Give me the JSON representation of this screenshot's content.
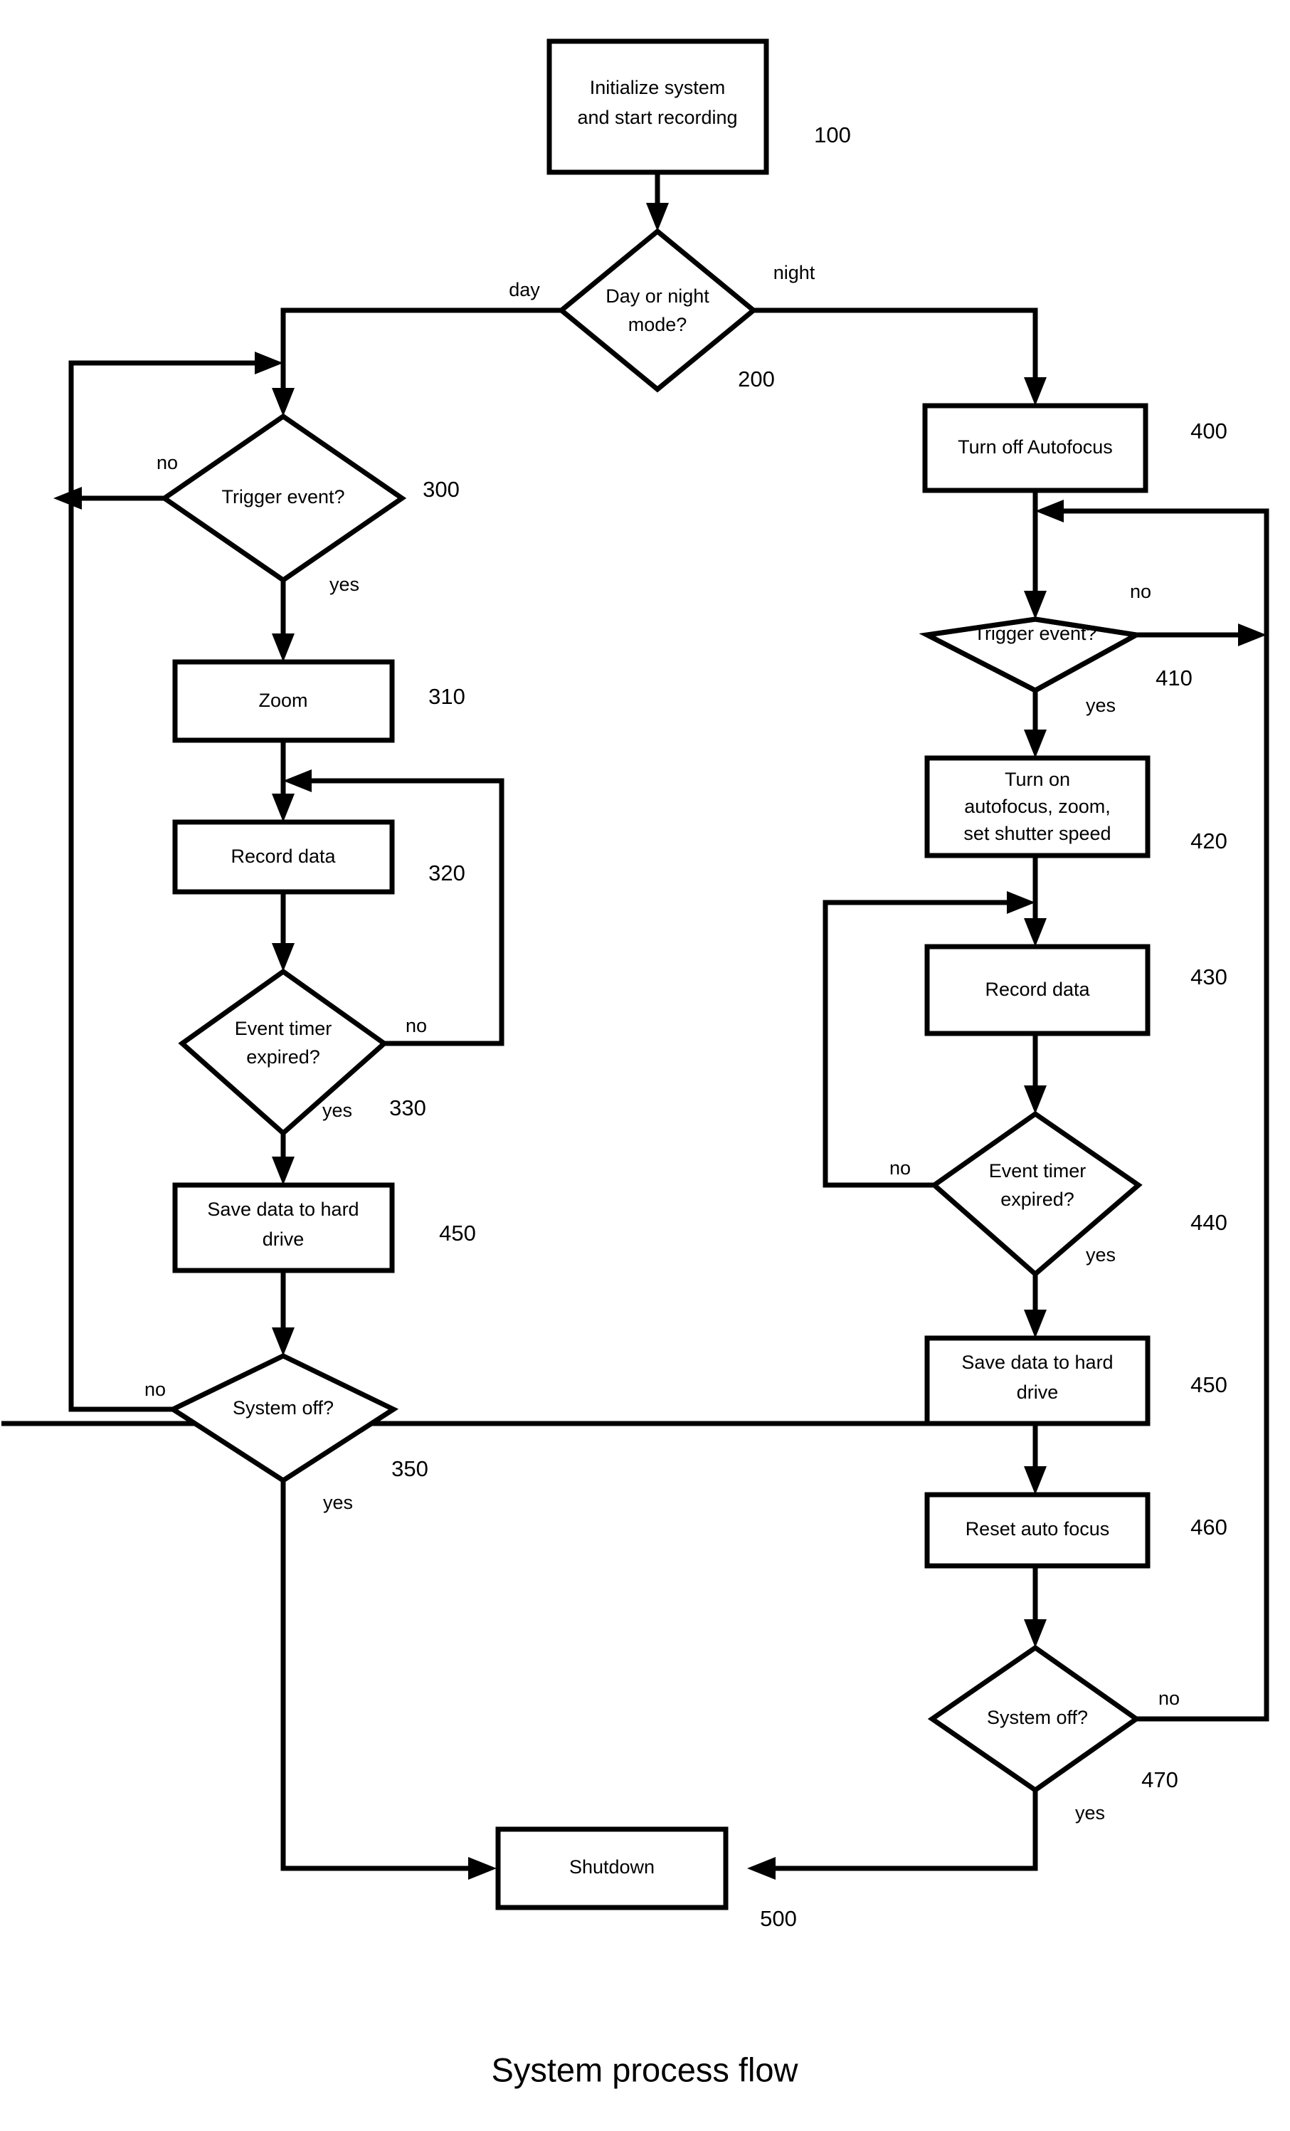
{
  "figure": {
    "caption": "System process flow",
    "background_color": "#ffffff",
    "line_color": "#000000",
    "text_color": "#000000"
  },
  "nodes": {
    "initialize": {
      "ref": "100",
      "shape": "process",
      "line1": "Initialize system",
      "line2": "and start recording"
    },
    "day_or_night": {
      "ref": "200",
      "shape": "decision",
      "line1": "Day or night",
      "line2": "mode?"
    },
    "day_trigger": {
      "ref": "300",
      "shape": "decision",
      "line1": "Trigger event?",
      "line2": ""
    },
    "day_zoom": {
      "ref": "310",
      "shape": "process",
      "line1": "Zoom",
      "line2": ""
    },
    "day_record": {
      "ref": "320",
      "shape": "process",
      "line1": "Record data",
      "line2": ""
    },
    "day_timer": {
      "ref": "330",
      "shape": "decision",
      "line1": "Event timer",
      "line2": "expired?"
    },
    "day_save": {
      "ref": "450",
      "shape": "process",
      "line1": "Save data to hard",
      "line2": "drive"
    },
    "day_system_off": {
      "ref": "350",
      "shape": "decision",
      "line1": "System off?",
      "line2": ""
    },
    "night_autofocus_off": {
      "ref": "400",
      "shape": "process",
      "line1": "Turn off Autofocus",
      "line2": ""
    },
    "night_trigger": {
      "ref": "410",
      "shape": "decision",
      "line1": "Trigger event?",
      "line2": ""
    },
    "night_turn_on": {
      "ref": "420",
      "shape": "process",
      "line1": "Turn on",
      "line2": "autofocus, zoom,",
      "line3": "set shutter speed"
    },
    "night_record": {
      "ref": "430",
      "shape": "process",
      "line1": "Record data",
      "line2": ""
    },
    "night_timer": {
      "ref": "440",
      "shape": "decision",
      "line1": "Event timer",
      "line2": "expired?"
    },
    "night_save": {
      "ref": "450",
      "shape": "process",
      "line1": "Save data to hard",
      "line2": "drive"
    },
    "night_reset_focus": {
      "ref": "460",
      "shape": "process",
      "line1": "Reset auto focus",
      "line2": ""
    },
    "night_system_off": {
      "ref": "470",
      "shape": "decision",
      "line1": "System off?",
      "line2": ""
    },
    "shutdown": {
      "ref": "500",
      "shape": "process",
      "line1": "Shutdown",
      "line2": ""
    }
  },
  "edge_labels": {
    "day": "day",
    "night": "night",
    "day_trigger_no": "no",
    "day_trigger_yes": "yes",
    "day_timer_no": "no",
    "day_timer_yes": "yes",
    "day_system_off_no": "no",
    "day_system_off_yes": "yes",
    "night_trigger_no": "no",
    "night_trigger_yes": "yes",
    "night_timer_no": "no",
    "night_timer_yes": "yes",
    "night_system_off_no": "no",
    "night_system_off_yes": "yes"
  },
  "chart_data": {
    "type": "flowchart",
    "title": "System process flow",
    "orientation": "top-down, two parallel branches (day / night)",
    "nodes": [
      {
        "id": "100",
        "label": "Initialize system and start recording",
        "type": "process"
      },
      {
        "id": "200",
        "label": "Day or night mode?",
        "type": "decision"
      },
      {
        "id": "300",
        "label": "Trigger event?",
        "type": "decision",
        "branch": "day"
      },
      {
        "id": "310",
        "label": "Zoom",
        "type": "process",
        "branch": "day"
      },
      {
        "id": "320",
        "label": "Record data",
        "type": "process",
        "branch": "day"
      },
      {
        "id": "330",
        "label": "Event timer expired?",
        "type": "decision",
        "branch": "day"
      },
      {
        "id": "450",
        "label": "Save data to hard drive",
        "type": "process",
        "branch": "day"
      },
      {
        "id": "350",
        "label": "System off?",
        "type": "decision",
        "branch": "day"
      },
      {
        "id": "400",
        "label": "Turn off Autofocus",
        "type": "process",
        "branch": "night"
      },
      {
        "id": "410",
        "label": "Trigger event?",
        "type": "decision",
        "branch": "night"
      },
      {
        "id": "420",
        "label": "Turn on autofocus, zoom, set shutter speed",
        "type": "process",
        "branch": "night"
      },
      {
        "id": "430",
        "label": "Record data",
        "type": "process",
        "branch": "night"
      },
      {
        "id": "440",
        "label": "Event timer expired?",
        "type": "decision",
        "branch": "night"
      },
      {
        "id": "450b",
        "label": "Save data to hard drive",
        "type": "process",
        "branch": "night"
      },
      {
        "id": "460",
        "label": "Reset auto focus",
        "type": "process",
        "branch": "night"
      },
      {
        "id": "470",
        "label": "System off?",
        "type": "decision",
        "branch": "night"
      },
      {
        "id": "500",
        "label": "Shutdown",
        "type": "process"
      }
    ],
    "edges": [
      {
        "from": "100",
        "to": "200",
        "label": ""
      },
      {
        "from": "200",
        "to": "300",
        "label": "day"
      },
      {
        "from": "200",
        "to": "400",
        "label": "night"
      },
      {
        "from": "300",
        "to": "300",
        "label": "no",
        "note": "loops back to input of 300"
      },
      {
        "from": "300",
        "to": "310",
        "label": "yes"
      },
      {
        "from": "310",
        "to": "320",
        "label": ""
      },
      {
        "from": "320",
        "to": "330",
        "label": ""
      },
      {
        "from": "330",
        "to": "320",
        "label": "no"
      },
      {
        "from": "330",
        "to": "450",
        "label": "yes"
      },
      {
        "from": "450",
        "to": "350",
        "label": ""
      },
      {
        "from": "350",
        "to": "300",
        "label": "no"
      },
      {
        "from": "350",
        "to": "500",
        "label": "yes"
      },
      {
        "from": "400",
        "to": "410",
        "label": ""
      },
      {
        "from": "410",
        "to": "410",
        "label": "no",
        "note": "loops back to input of 410"
      },
      {
        "from": "410",
        "to": "420",
        "label": "yes"
      },
      {
        "from": "420",
        "to": "430",
        "label": ""
      },
      {
        "from": "430",
        "to": "440",
        "label": ""
      },
      {
        "from": "440",
        "to": "430",
        "label": "no"
      },
      {
        "from": "440",
        "to": "450b",
        "label": "yes"
      },
      {
        "from": "450b",
        "to": "460",
        "label": ""
      },
      {
        "from": "460",
        "to": "470",
        "label": ""
      },
      {
        "from": "470",
        "to": "410",
        "label": "no"
      },
      {
        "from": "470",
        "to": "500",
        "label": "yes"
      }
    ]
  }
}
